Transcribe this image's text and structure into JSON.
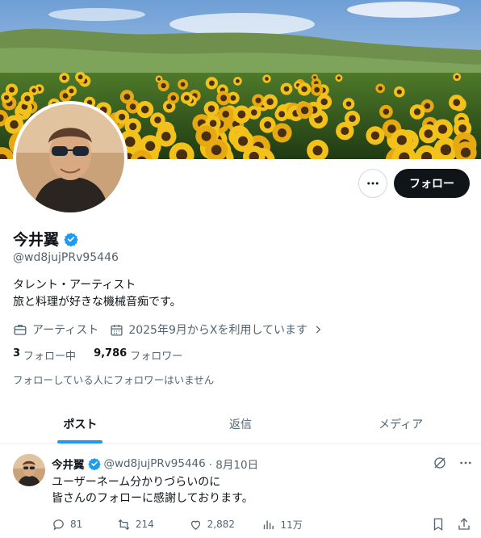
{
  "profile": {
    "name": "今井翼",
    "handle": "@wd8jujPRv95446",
    "bio_line1": "タレント・アーティスト",
    "bio_line2": "旅と料理が好きな機械音痴です。",
    "category": "アーティスト",
    "joined": "2025年9月からXを利用しています",
    "following_count": "3",
    "following_label": "フォロー中",
    "followers_count": "9,786",
    "followers_label": "フォロワー",
    "no_mutual_text": "フォローしている人にフォロワーはいません",
    "follow_button": "フォロー"
  },
  "tabs": [
    {
      "label": "ポスト",
      "active": true
    },
    {
      "label": "返信",
      "active": false
    },
    {
      "label": "メディア",
      "active": false
    }
  ],
  "post": {
    "name": "今井翼",
    "handle": "@wd8jujPRv95446",
    "date": "· 8月10日",
    "line1": "ユーザーネーム分かりづらいのに",
    "line2": "皆さんのフォローに感謝しております。",
    "replies": "81",
    "reposts": "214",
    "likes": "2,882",
    "views": "11万"
  },
  "colors": {
    "accent": "#1d9bf0",
    "text": "#0f1419",
    "muted": "#536471",
    "border": "#eff3f4"
  }
}
